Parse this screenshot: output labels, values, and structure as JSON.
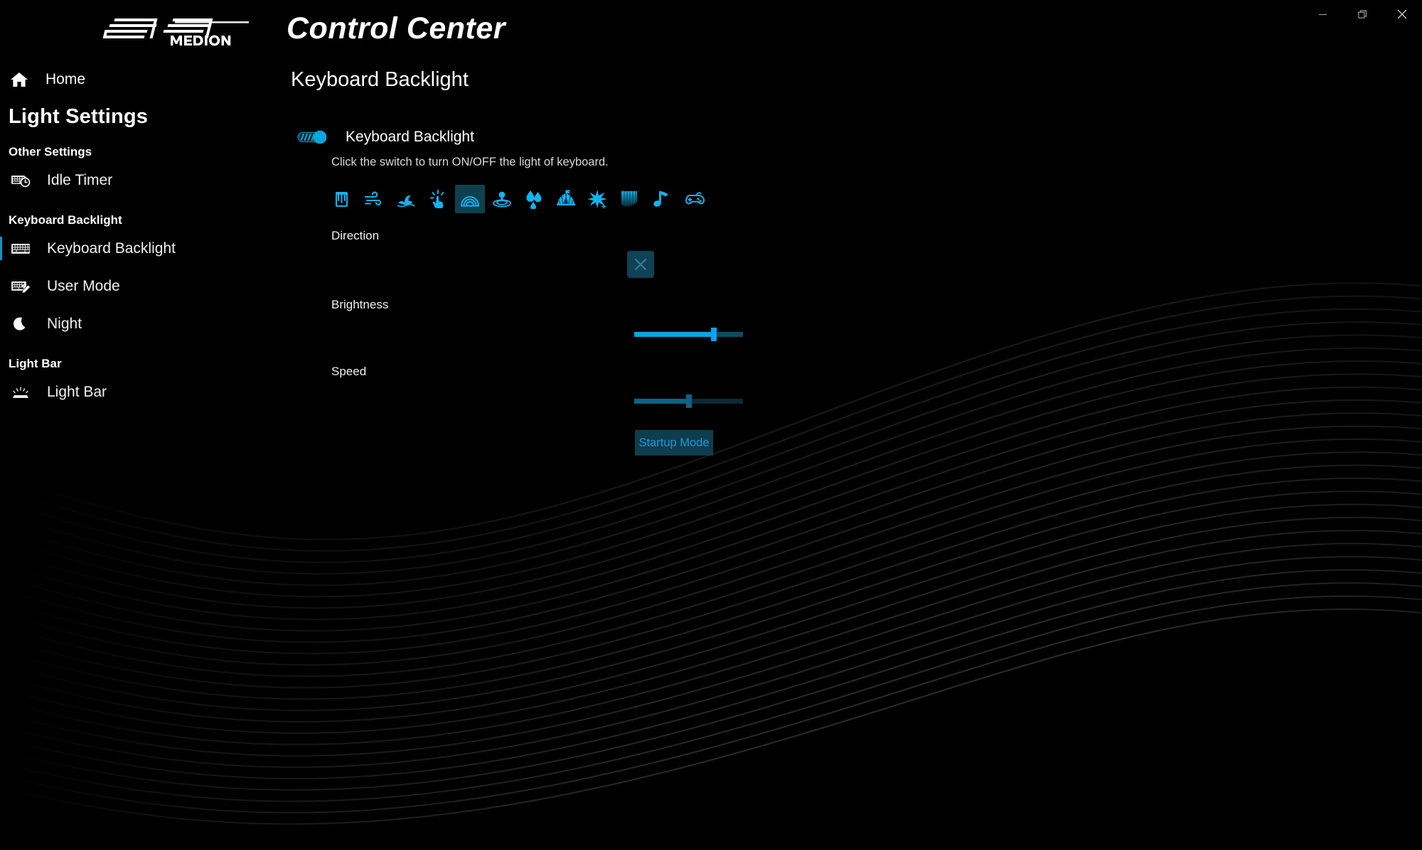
{
  "window": {
    "controls": [
      {
        "name": "minimize",
        "glyph": "minimize-icon"
      },
      {
        "name": "restore",
        "glyph": "restore-icon"
      },
      {
        "name": "close",
        "glyph": "close-icon"
      }
    ]
  },
  "brand": {
    "logo_primary": "erazer",
    "logo_secondary": "MEDION",
    "title": "Control Center"
  },
  "sidebar": {
    "home_label": "Home",
    "title": "Light Settings",
    "groups": [
      {
        "heading": "Other Settings",
        "items": [
          {
            "label": "Idle Timer",
            "icon": "keyboard-timer-icon",
            "active": false
          }
        ]
      },
      {
        "heading": "Keyboard Backlight",
        "items": [
          {
            "label": "Keyboard Backlight",
            "icon": "keyboard-icon",
            "active": true
          },
          {
            "label": "User Mode",
            "icon": "keyboard-edit-icon",
            "active": false
          },
          {
            "label": "Night",
            "icon": "moon-icon",
            "active": false
          }
        ]
      },
      {
        "heading": "Light Bar",
        "items": [
          {
            "label": "Light Bar",
            "icon": "light-bar-icon",
            "active": false
          }
        ]
      }
    ]
  },
  "main": {
    "page_title": "Keyboard Backlight",
    "toggle": {
      "label": "Keyboard Backlight",
      "state": "on",
      "hint": "Click the switch to turn ON/OFF the light of keyboard."
    },
    "effects": {
      "selected_index": 4,
      "items": [
        {
          "name": "paint-bucket-icon",
          "label": "Paint"
        },
        {
          "name": "wind-icon",
          "label": "Wind"
        },
        {
          "name": "wave-icon",
          "label": "Wave"
        },
        {
          "name": "touch-icon",
          "label": "Touch"
        },
        {
          "name": "rainbow-icon",
          "label": "Rainbow"
        },
        {
          "name": "ripple-icon",
          "label": "Ripple"
        },
        {
          "name": "raindrop-icon",
          "label": "Raindrop"
        },
        {
          "name": "tent-icon",
          "label": "Tent"
        },
        {
          "name": "sparkle-icon",
          "label": "Sparkle"
        },
        {
          "name": "waterfall-icon",
          "label": "Waterfall"
        },
        {
          "name": "music-note-icon",
          "label": "Music"
        },
        {
          "name": "gamepad-icon",
          "label": "Game"
        }
      ]
    },
    "direction": {
      "label": "Direction",
      "button_icon": "close-x-icon",
      "button_state": "disabled"
    },
    "brightness": {
      "label": "Brightness",
      "value_percent": 73,
      "enabled": true
    },
    "speed": {
      "label": "Speed",
      "value_percent": 50,
      "enabled": false
    },
    "startup_button": {
      "label": "Startup Mode"
    }
  },
  "colors": {
    "accent": "#0aa5e0",
    "accent_dim": "#12617d",
    "accent_text": "#2196d4",
    "panel_selected": "#10404f",
    "background": "#000000",
    "text": "#ffffff"
  }
}
